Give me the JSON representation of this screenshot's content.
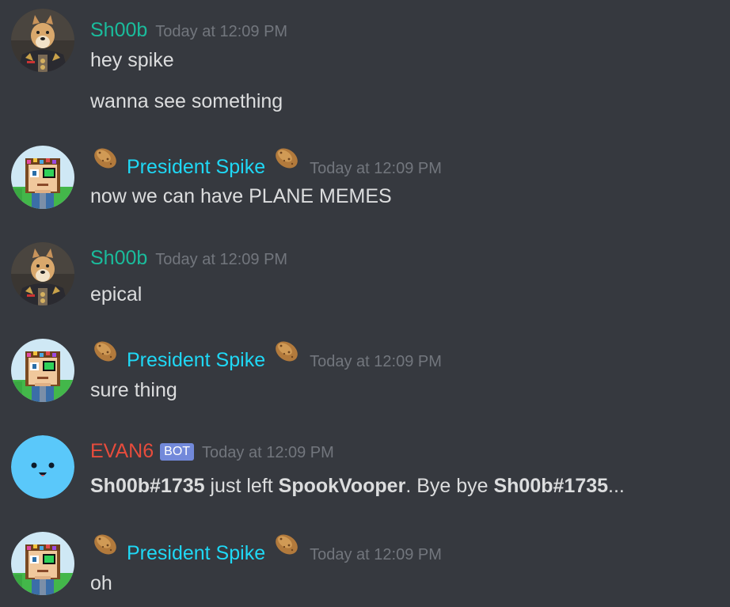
{
  "colors": {
    "background": "#36393f",
    "text": "#dcddde",
    "timestamp": "#72767d",
    "shoob": "#1abc9c",
    "spike": "#1fd8f5",
    "evan": "#e74c3c",
    "bot_tag": "#7289da"
  },
  "messages": [
    {
      "author": "Sh00b",
      "avatar": "doge-general-avatar",
      "timestamp": "Today at 12:09 PM",
      "lines": [
        "hey spike",
        "wanna see something"
      ]
    },
    {
      "author": "President Spike",
      "avatar": "pixel-spike-avatar",
      "decorations": "potato-emoji",
      "timestamp": "Today at 12:09 PM",
      "lines": [
        "now we can have PLANE MEMES"
      ]
    },
    {
      "author": "Sh00b",
      "avatar": "doge-general-avatar",
      "timestamp": "Today at 12:09 PM",
      "lines": [
        "epical"
      ]
    },
    {
      "author": "President Spike",
      "avatar": "pixel-spike-avatar",
      "decorations": "potato-emoji",
      "timestamp": "Today at 12:09 PM",
      "lines": [
        "sure thing"
      ]
    },
    {
      "author": "EVAN6",
      "avatar": "smiley-face-avatar",
      "badge": "BOT",
      "timestamp": "Today at 12:09 PM",
      "bot_message": {
        "user1": "Sh00b#1735",
        "part1": " just left ",
        "server": "SpookVooper",
        "part2": ". Bye bye ",
        "user2": "Sh00b#1735",
        "part3": "..."
      }
    },
    {
      "author": "President Spike",
      "avatar": "pixel-spike-avatar",
      "decorations": "potato-emoji",
      "timestamp": "Today at 12:09 PM",
      "lines": [
        "oh"
      ]
    }
  ]
}
